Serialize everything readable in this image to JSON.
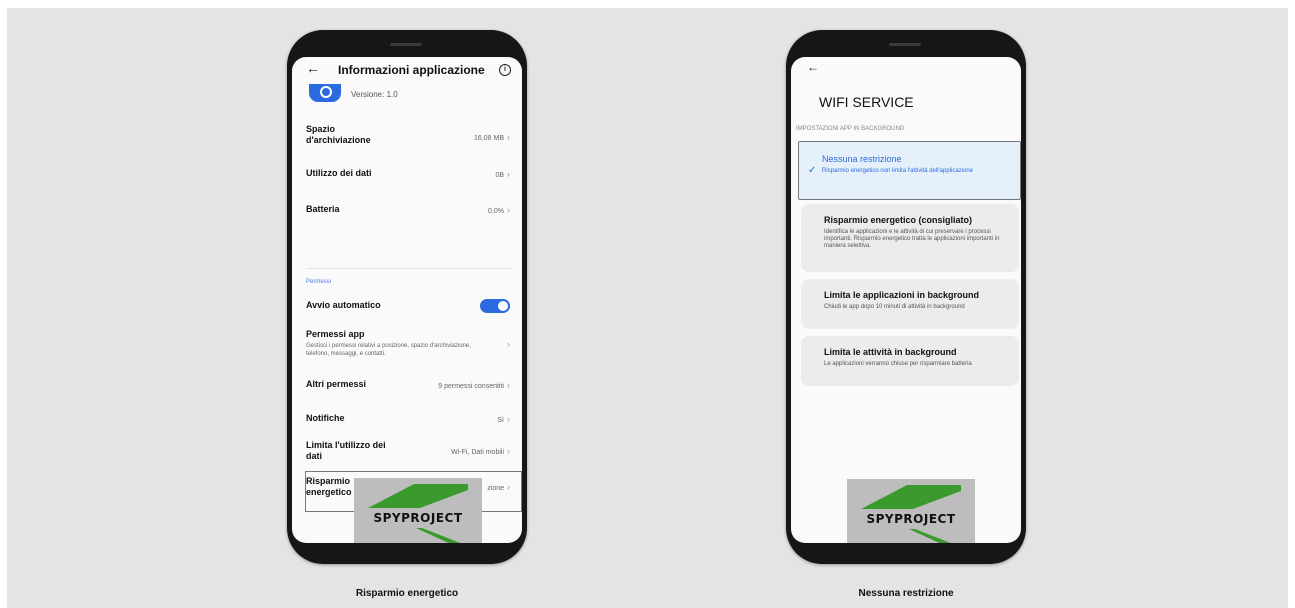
{
  "left_phone": {
    "header": {
      "back_icon": "arrow-left-icon",
      "title": "Informazioni applicazione",
      "info_icon": "info-circle-icon"
    },
    "app": {
      "version": "Versione: 1.0"
    },
    "rows": [
      {
        "label": "Spazio d'archiviazione",
        "value": "16,08 MB"
      },
      {
        "label": "Utilizzo dei dati",
        "value": "0B"
      },
      {
        "label": "Batteria",
        "value": "0,0%"
      }
    ],
    "permissions_section": "Permessi",
    "autostart": {
      "label": "Avvio automatico"
    },
    "app_permissions": {
      "label": "Permessi app",
      "desc": "Gestisci i permessi relativi a posizione, spazio d'archiviazione, telefono, messaggi, e contatti."
    },
    "other_permissions": {
      "label": "Altri permessi",
      "value": "9 permessi consentiti"
    },
    "notifications": {
      "label": "Notifiche",
      "value": "Sì"
    },
    "data_limit": {
      "label": "Limita l'utilizzo dei dati",
      "value": "Wi-Fi, Dati mobili"
    },
    "battery_saver": {
      "label": "Risparmio energetico",
      "value": "zione"
    },
    "logo_text": "SPYPROJECT",
    "caption": "Risparmio energetico"
  },
  "right_phone": {
    "back_icon": "arrow-left-icon",
    "title": "WIFI SERVICE",
    "section": "IMPOSTAZIONI APP IN BACKGROUND",
    "options": [
      {
        "title": "Nessuna restrizione",
        "desc": "Risparmio energetico non limita l'attività dell'applicazione",
        "selected": true
      },
      {
        "title": "Risparmio energetico (consigliato)",
        "desc": "Identifica le applicazioni e le attività di cui preservare i processi importanti. Risparmio energetico tratta le applicazioni importanti in maniera selettiva.",
        "selected": false
      },
      {
        "title": "Limita le applicazioni in background",
        "desc": "Chiudi le app dopo 10 minuti di attività in background",
        "selected": false
      },
      {
        "title": "Limita le attività in background",
        "desc": "Le applicazioni verranno chiuse per risparmiare batteria",
        "selected": false
      }
    ],
    "logo_text": "SPYPROJECT",
    "caption": "Nessuna restrizione"
  },
  "colors": {
    "accent": "#2a6be0",
    "logo_green": "#3a9a2e",
    "background": "#e4e4e4"
  }
}
